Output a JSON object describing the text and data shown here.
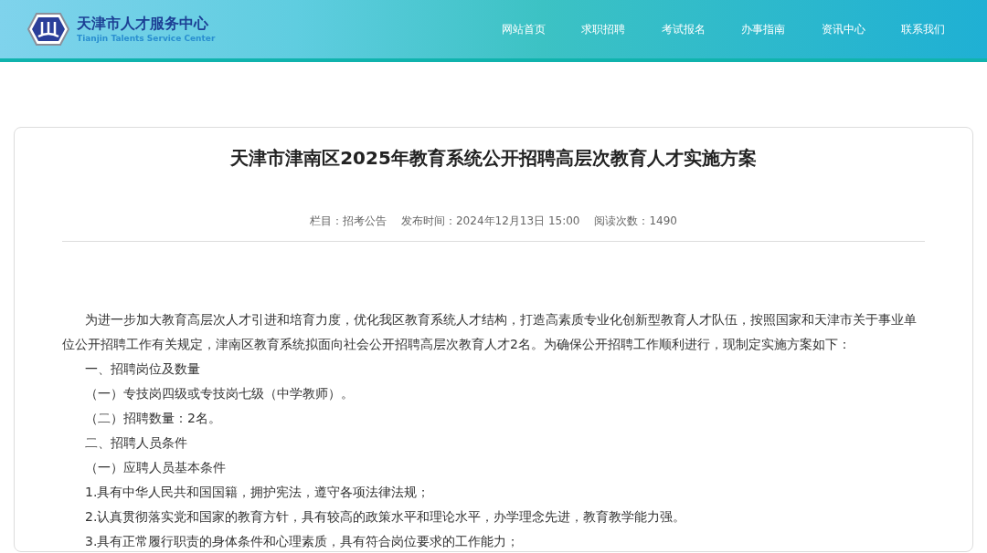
{
  "header": {
    "logo_title": "天津市人才服务中心",
    "logo_subtitle": "Tianjin Talents Service Center",
    "nav": [
      {
        "label": "网站首页"
      },
      {
        "label": "求职招聘"
      },
      {
        "label": "考试报名"
      },
      {
        "label": "办事指南"
      },
      {
        "label": "资讯中心"
      },
      {
        "label": "联系我们"
      }
    ]
  },
  "article": {
    "title": "天津市津南区2025年教育系统公开招聘高层次教育人才实施方案",
    "meta": [
      "栏目：招考公告",
      "发布时间：2024年12月13日 15:00",
      "阅读次数：1490"
    ],
    "paragraphs": [
      "为进一步加大教育高层次人才引进和培育力度，优化我区教育系统人才结构，打造高素质专业化创新型教育人才队伍，按照国家和天津市关于事业单位公开招聘工作有关规定，津南区教育系统拟面向社会公开招聘高层次教育人才2名。为确保公开招聘工作顺利进行，现制定实施方案如下：",
      "一、招聘岗位及数量",
      "（一）专技岗四级或专技岗七级（中学教师）。",
      "（二）招聘数量：2名。",
      "二、招聘人员条件",
      "（一）应聘人员基本条件",
      "1.具有中华人民共和国国籍，拥护宪法，遵守各项法律法规；",
      "2.认真贯彻落实党和国家的教育方针，具有较高的政策水平和理论水平，办学理念先进，教育教学能力强。",
      "3.具有正常履行职责的身体条件和心理素质，具有符合岗位要求的工作能力；"
    ]
  }
}
